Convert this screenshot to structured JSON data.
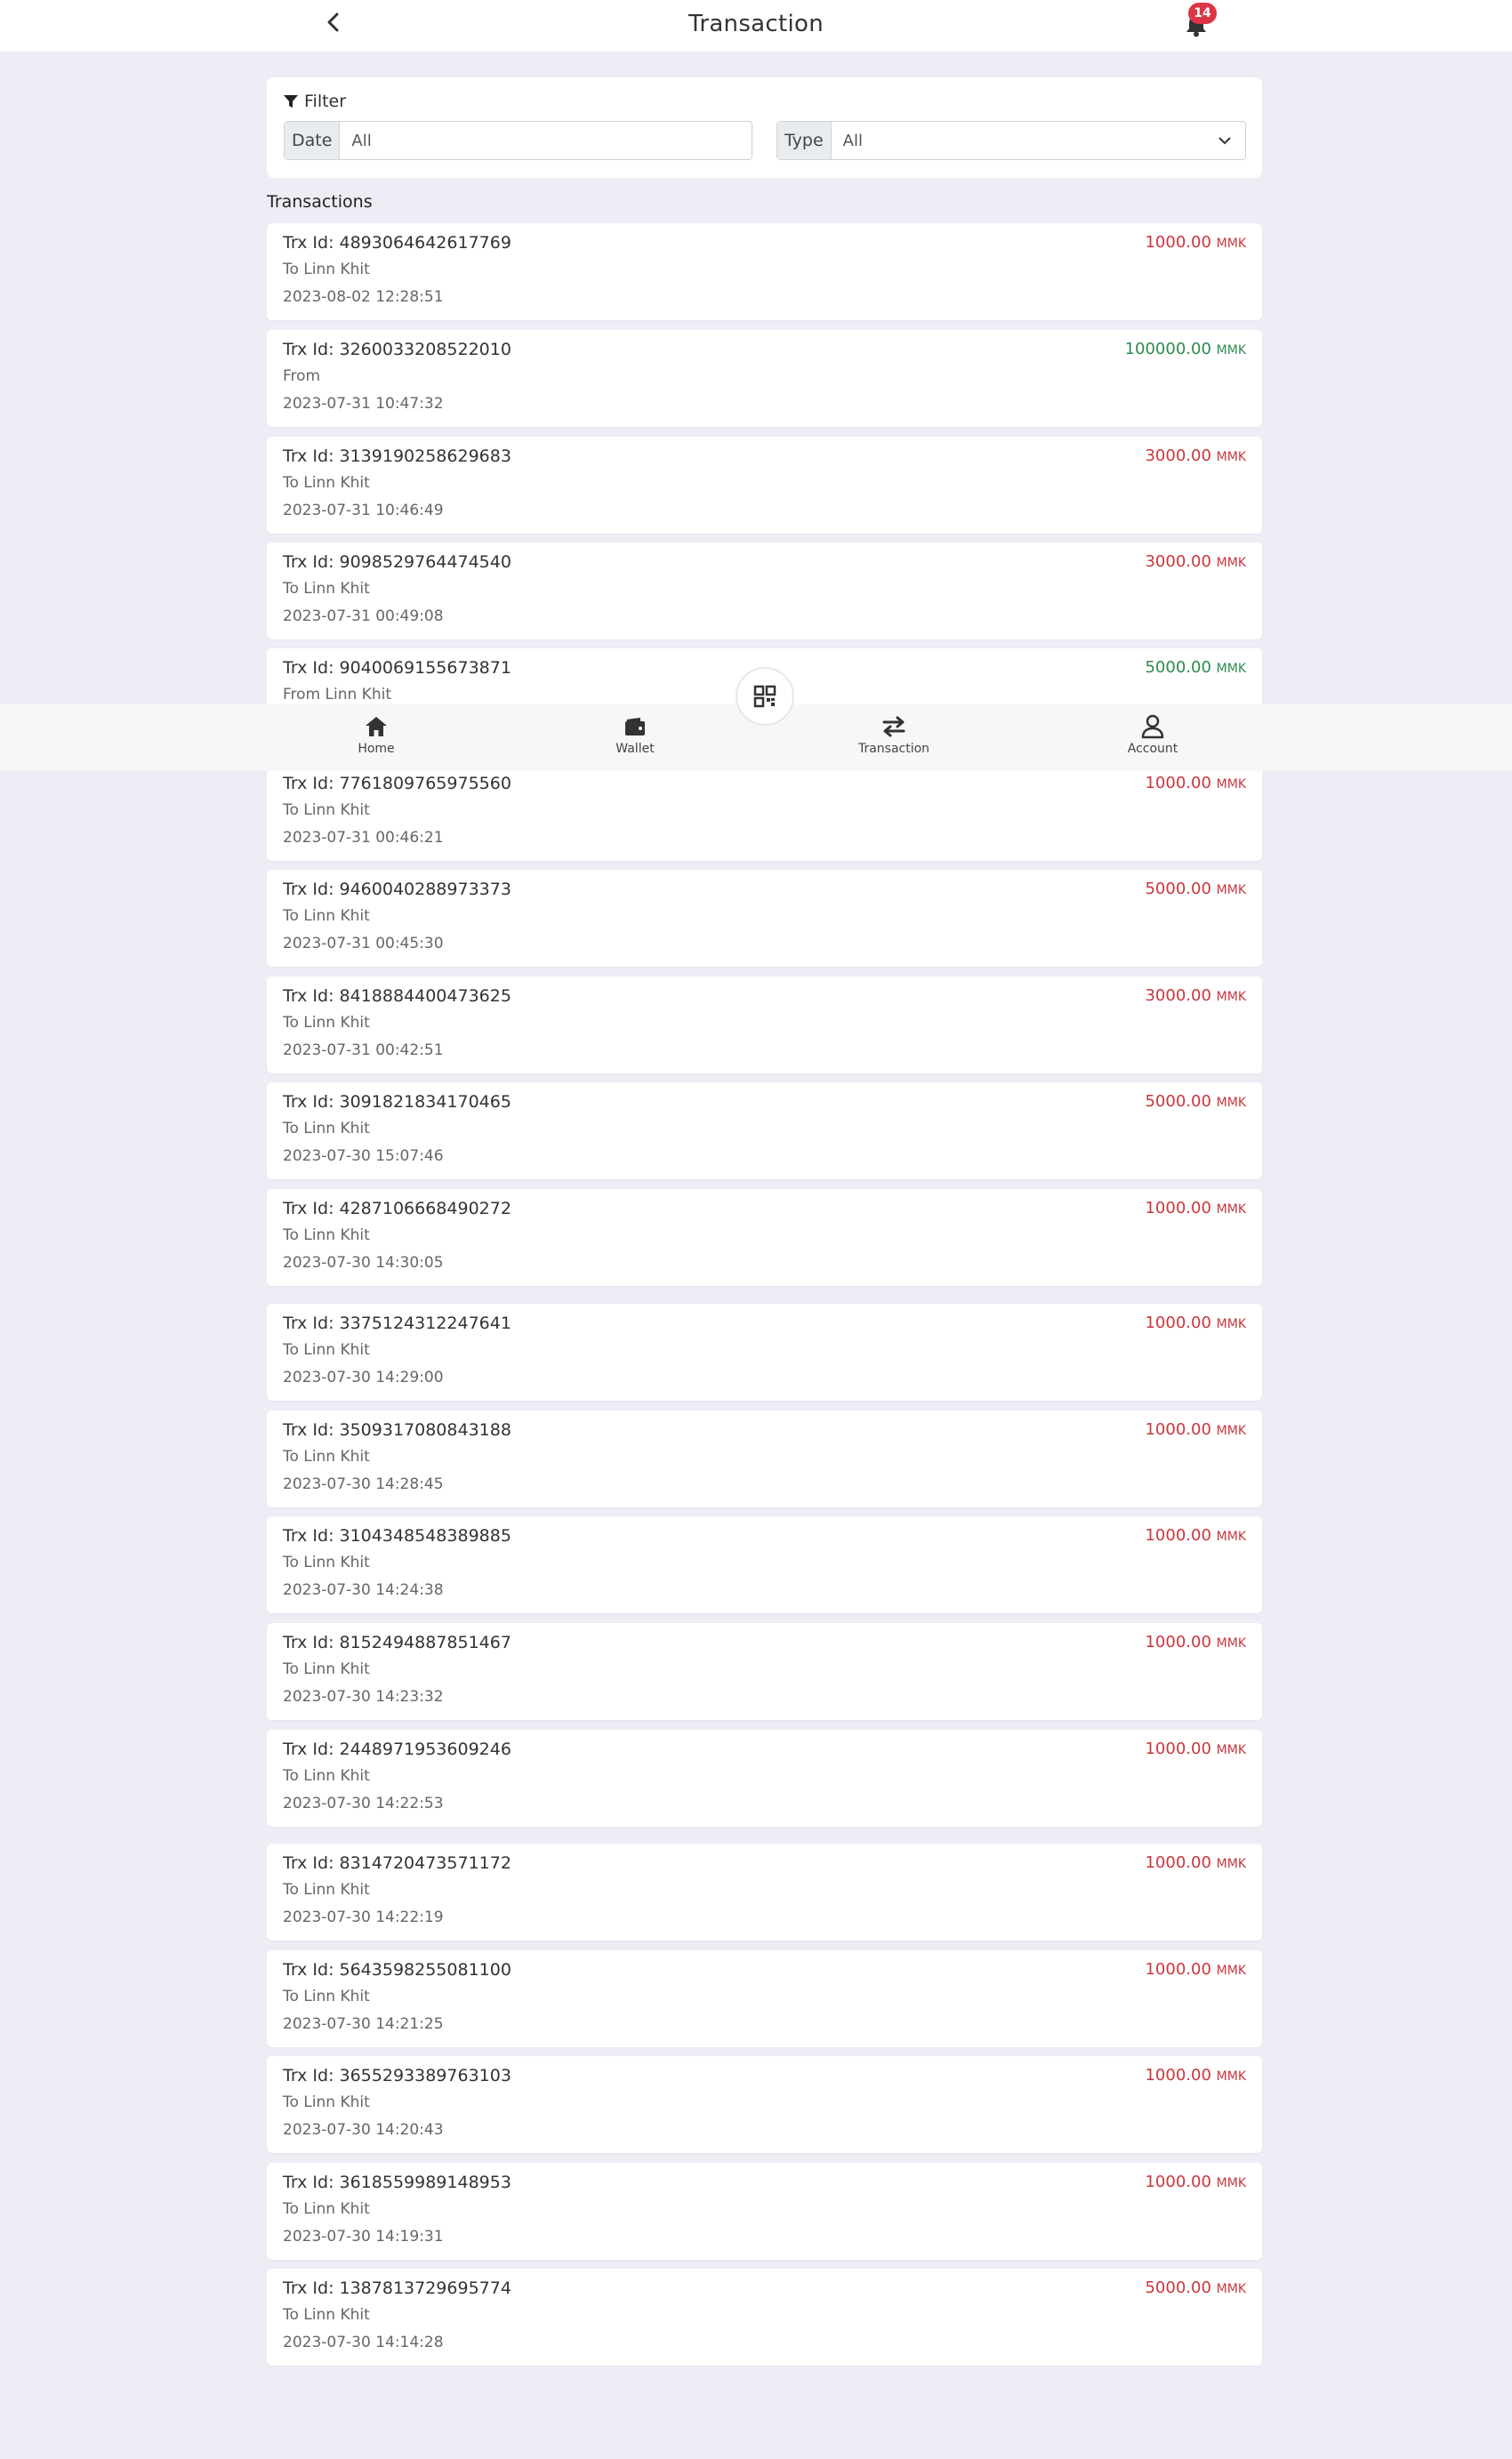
{
  "header": {
    "title": "Transaction",
    "notification_count": "14"
  },
  "filter": {
    "title": "Filter",
    "date_label": "Date",
    "date_value": "All",
    "type_label": "Type",
    "type_value": "All"
  },
  "transactions_label": "Transactions",
  "transactions": [
    {
      "id": "Trx Id: 4893064642617769",
      "party": "To Linn Khit",
      "date": "2023-08-02 12:28:51",
      "amount": "1000.00",
      "currency": "MMK",
      "direction": "out"
    },
    {
      "id": "Trx Id: 3260033208522010",
      "party": "From",
      "date": "2023-07-31 10:47:32",
      "amount": "100000.00",
      "currency": "MMK",
      "direction": "in"
    },
    {
      "id": "Trx Id: 3139190258629683",
      "party": "To Linn Khit",
      "date": "2023-07-31 10:46:49",
      "amount": "3000.00",
      "currency": "MMK",
      "direction": "out"
    },
    {
      "id": "Trx Id: 9098529764474540",
      "party": "To Linn Khit",
      "date": "2023-07-31 00:49:08",
      "amount": "3000.00",
      "currency": "MMK",
      "direction": "out"
    },
    {
      "id": "Trx Id: 9040069155673871",
      "party": "From Linn Khit",
      "date": "",
      "amount": "5000.00",
      "currency": "MMK",
      "direction": "in"
    },
    {
      "id": "Trx Id: 7761809765975560",
      "party": "To Linn Khit",
      "date": "2023-07-31 00:46:21",
      "amount": "1000.00",
      "currency": "MMK",
      "direction": "out"
    },
    {
      "id": "Trx Id: 9460040288973373",
      "party": "To Linn Khit",
      "date": "2023-07-31 00:45:30",
      "amount": "5000.00",
      "currency": "MMK",
      "direction": "out"
    },
    {
      "id": "Trx Id: 8418884400473625",
      "party": "To Linn Khit",
      "date": "2023-07-31 00:42:51",
      "amount": "3000.00",
      "currency": "MMK",
      "direction": "out"
    },
    {
      "id": "Trx Id: 3091821834170465",
      "party": "To Linn Khit",
      "date": "2023-07-30 15:07:46",
      "amount": "5000.00",
      "currency": "MMK",
      "direction": "out"
    },
    {
      "id": "Trx Id: 4287106668490272",
      "party": "To Linn Khit",
      "date": "2023-07-30 14:30:05",
      "amount": "1000.00",
      "currency": "MMK",
      "direction": "out"
    },
    {
      "id": "Trx Id: 3375124312247641",
      "party": "To Linn Khit",
      "date": "2023-07-30 14:29:00",
      "amount": "1000.00",
      "currency": "MMK",
      "direction": "out"
    },
    {
      "id": "Trx Id: 3509317080843188",
      "party": "To Linn Khit",
      "date": "2023-07-30 14:28:45",
      "amount": "1000.00",
      "currency": "MMK",
      "direction": "out"
    },
    {
      "id": "Trx Id: 3104348548389885",
      "party": "To Linn Khit",
      "date": "2023-07-30 14:24:38",
      "amount": "1000.00",
      "currency": "MMK",
      "direction": "out"
    },
    {
      "id": "Trx Id: 8152494887851467",
      "party": "To Linn Khit",
      "date": "2023-07-30 14:23:32",
      "amount": "1000.00",
      "currency": "MMK",
      "direction": "out"
    },
    {
      "id": "Trx Id: 2448971953609246",
      "party": "To Linn Khit",
      "date": "2023-07-30 14:22:53",
      "amount": "1000.00",
      "currency": "MMK",
      "direction": "out"
    },
    {
      "id": "Trx Id: 8314720473571172",
      "party": "To Linn Khit",
      "date": "2023-07-30 14:22:19",
      "amount": "1000.00",
      "currency": "MMK",
      "direction": "out"
    },
    {
      "id": "Trx Id: 5643598255081100",
      "party": "To Linn Khit",
      "date": "2023-07-30 14:21:25",
      "amount": "1000.00",
      "currency": "MMK",
      "direction": "out"
    },
    {
      "id": "Trx Id: 3655293389763103",
      "party": "To Linn Khit",
      "date": "2023-07-30 14:20:43",
      "amount": "1000.00",
      "currency": "MMK",
      "direction": "out"
    },
    {
      "id": "Trx Id: 3618559989148953",
      "party": "To Linn Khit",
      "date": "2023-07-30 14:19:31",
      "amount": "1000.00",
      "currency": "MMK",
      "direction": "out"
    },
    {
      "id": "Trx Id: 1387813729695774",
      "party": "To Linn Khit",
      "date": "2023-07-30 14:14:28",
      "amount": "5000.00",
      "currency": "MMK",
      "direction": "out"
    }
  ],
  "nav": {
    "home": "Home",
    "wallet": "Wallet",
    "transaction": "Transaction",
    "account": "Account"
  },
  "colors": {
    "background": "#ededf5",
    "outgoing": "#c8373e",
    "incoming": "#2e8a4e",
    "badge": "#dc3545"
  },
  "icons": {
    "back": "chevron-left-icon",
    "notification": "bell-icon",
    "filter": "filter-icon",
    "dropdown": "chevron-down-icon",
    "qr": "qr-code-icon",
    "home": "home-icon",
    "wallet": "wallet-icon",
    "transaction": "transfer-arrows-icon",
    "account": "user-icon"
  }
}
